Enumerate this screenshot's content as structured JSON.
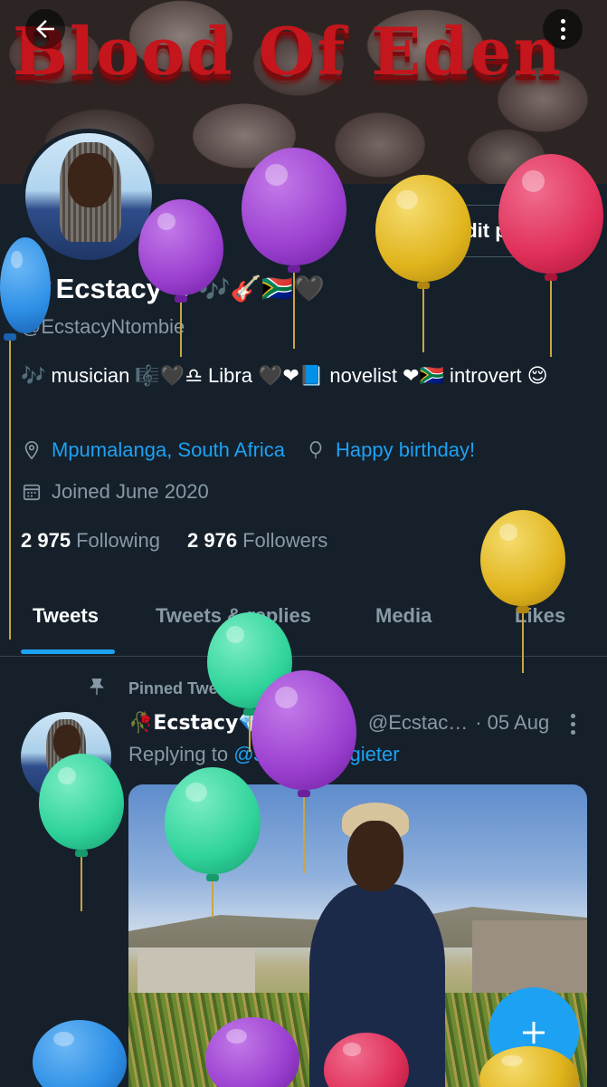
{
  "banner": {
    "title": "Blood Of Eden"
  },
  "profile": {
    "edit_label": "Edit profile",
    "name": "Ecstacy",
    "name_prefix_emoji": "🥀",
    "name_suffix_emojis": "💎🎶🎸🇿🇦🖤",
    "handle": "@EcstacyNtombie",
    "bio": "🎶 musician 🎼🖤♎ Libra 🖤❤📘 novelist ❤🇿🇦 introvert 😌",
    "location": "Mpumalanga, South Africa",
    "birthday": "Happy birthday!",
    "joined": "Joined June 2020",
    "following_count": "2 975",
    "following_label": "Following",
    "followers_count": "2 976",
    "followers_label": "Followers"
  },
  "tabs": [
    {
      "label": "Tweets",
      "active": true
    },
    {
      "label": "Tweets & replies",
      "active": false
    },
    {
      "label": "Media",
      "active": false
    },
    {
      "label": "Likes",
      "active": false
    }
  ],
  "tweet": {
    "pinned_label": "Pinned Tweet",
    "author": "🥀Ecstacy💎🎶🎸🇿🇦",
    "handle": "@Ecstac…",
    "date": "· 05 Aug",
    "replying_prefix": "Replying to",
    "replying_to": "@JanVanPotgieter"
  },
  "icons": {
    "back": "arrow-left-icon",
    "more": "more-vertical-icon",
    "location": "location-pin-icon",
    "birthday": "balloon-icon",
    "joined": "calendar-icon",
    "pin": "pin-icon",
    "compose": "plus-icon"
  },
  "colors": {
    "background": "#15202b",
    "accent": "#1da1f2",
    "muted_text": "#8899a6",
    "banner_title": "#c4161c",
    "balloon_purple": "#9b3fd0",
    "balloon_yellow": "#e0b41c",
    "balloon_pink": "#e0305a",
    "balloon_green": "#2fd39a",
    "balloon_blue": "#2d8fe6"
  }
}
